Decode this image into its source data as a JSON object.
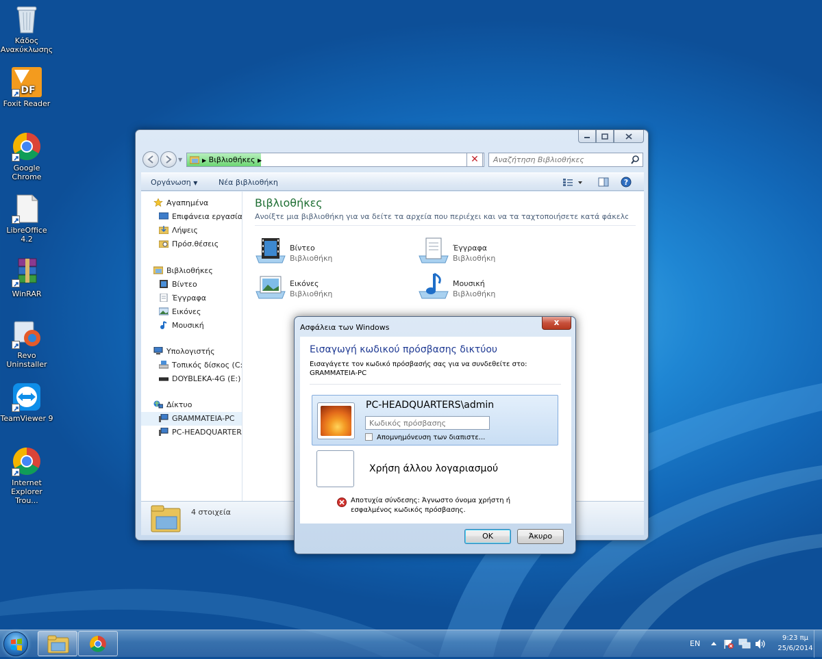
{
  "desktop": {
    "icons": [
      {
        "label": "Κάδος Ανακύκλωσης"
      },
      {
        "label": "Foxit Reader"
      },
      {
        "label": "Google Chrome"
      },
      {
        "label": "LibreOffice 4.2"
      },
      {
        "label": "WinRAR"
      },
      {
        "label": "Revo Uninstaller"
      },
      {
        "label": "TeamViewer 9"
      },
      {
        "label": "Internet Explorer Trou..."
      }
    ]
  },
  "explorer": {
    "breadcrumb": "Βιβλιοθήκες",
    "load_progress": 0.25,
    "search_placeholder": "Αναζήτηση Βιβλιοθήκες",
    "toolbar": {
      "organize": "Οργάνωση",
      "new_library": "Νέα βιβλιοθήκη"
    },
    "nav": {
      "favorites": "Αγαπημένα",
      "desktop": "Επιφάνεια εργασίας",
      "downloads": "Λήψεις",
      "recent": "Πρόσ.θέσεις",
      "libraries": "Βιβλιοθήκες",
      "videos": "Βίντεο",
      "documents": "Έγγραφα",
      "pictures": "Εικόνες",
      "music": "Μουσική",
      "computer": "Υπολογιστής",
      "local_disk": "Τοπικός δίσκος (C:)",
      "usb": "DOYBLEKA-4G (E:)",
      "network": "Δίκτυο",
      "pc1": "GRAMMATEIA-PC",
      "pc2": "PC-HEADQUARTERS"
    },
    "main": {
      "title": "Βιβλιοθήκες",
      "description": "Ανοίξτε μια βιβλιοθήκη για να δείτε τα αρχεία που περιέχει και να τα ταχτοποιήσετε κατά φάκελο, ημερομ...",
      "items": [
        {
          "name": "Βίντεο",
          "type": "Βιβλιοθήκη"
        },
        {
          "name": "Έγγραφα",
          "type": "Βιβλιοθήκη"
        },
        {
          "name": "Εικόνες",
          "type": "Βιβλιοθήκη"
        },
        {
          "name": "Μουσική",
          "type": "Βιβλιοθήκη"
        }
      ]
    },
    "status": "4 στοιχεία"
  },
  "dialog": {
    "title": "Ασφάλεια των Windows",
    "close": "x",
    "heading": "Εισαγωγή κωδικού πρόσβασης δικτύου",
    "instruction_line1": "Εισαγάγετε τον κωδικό πρόσβασής σας για να συνδεθείτε στο:",
    "instruction_line2": "GRAMMATEIA-PC",
    "user": "PC-HEADQUARTERS\\admin",
    "password_placeholder": "Κωδικός πρόσβασης",
    "remember": "Απομνημόνευση των διαπιστε...",
    "other_account": "Χρήση άλλου λογαριασμού",
    "error": "Αποτυχία σύνδεσης: Άγνωστο όνομα χρήστη ή εσφαλμένος κωδικός πρόσβασης.",
    "ok": "OK",
    "cancel": "Άκυρο"
  },
  "taskbar": {
    "language": "EN",
    "time": "9:23 πμ",
    "date": "25/6/2014"
  }
}
